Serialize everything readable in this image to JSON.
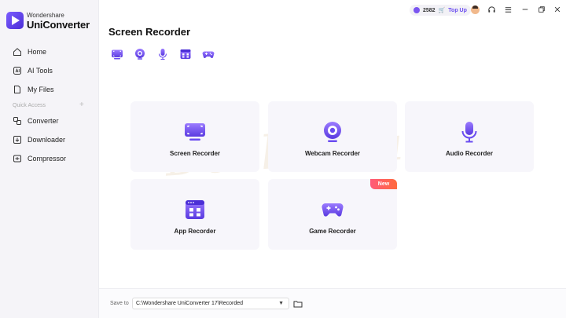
{
  "app": {
    "brand_small": "Wondershare",
    "brand_big": "UniConverter"
  },
  "sidebar": {
    "items": [
      {
        "label": "Home",
        "icon": "home-icon"
      },
      {
        "label": "AI Tools",
        "icon": "ai-icon"
      },
      {
        "label": "My Files",
        "icon": "file-icon"
      }
    ],
    "quick_access_label": "Quick Access",
    "quick_items": [
      {
        "label": "Converter",
        "icon": "converter-icon"
      },
      {
        "label": "Downloader",
        "icon": "download-icon"
      },
      {
        "label": "Compressor",
        "icon": "compress-icon"
      }
    ]
  },
  "topbar": {
    "credits": "2582",
    "top_up": "Top Up",
    "icons": [
      "avatar",
      "support-icon",
      "menu-icon",
      "minimize-icon",
      "maximize-icon",
      "close-icon"
    ]
  },
  "main": {
    "title": "Screen Recorder",
    "quick_icons": [
      "screen-icon",
      "webcam-icon",
      "mic-icon",
      "app-icon",
      "gamepad-icon"
    ],
    "cards": [
      {
        "label": "Screen Recorder",
        "icon": "screen-icon"
      },
      {
        "label": "Webcam Recorder",
        "icon": "webcam-icon"
      },
      {
        "label": "Audio Recorder",
        "icon": "mic-icon"
      },
      {
        "label": "App Recorder",
        "icon": "app-icon"
      },
      {
        "label": "Game Recorder",
        "icon": "gamepad-icon",
        "badge": "New"
      }
    ],
    "watermark": "Dealarious"
  },
  "footer": {
    "save_to_label": "Save to",
    "path": "C:\\Wondershare UniConverter 17\\Recorded"
  },
  "colors": {
    "accent": "#6a4cf0",
    "sidebar_bg": "#f5f4f8",
    "card_bg": "#f7f6fb",
    "badge": "#ff5a7a"
  }
}
